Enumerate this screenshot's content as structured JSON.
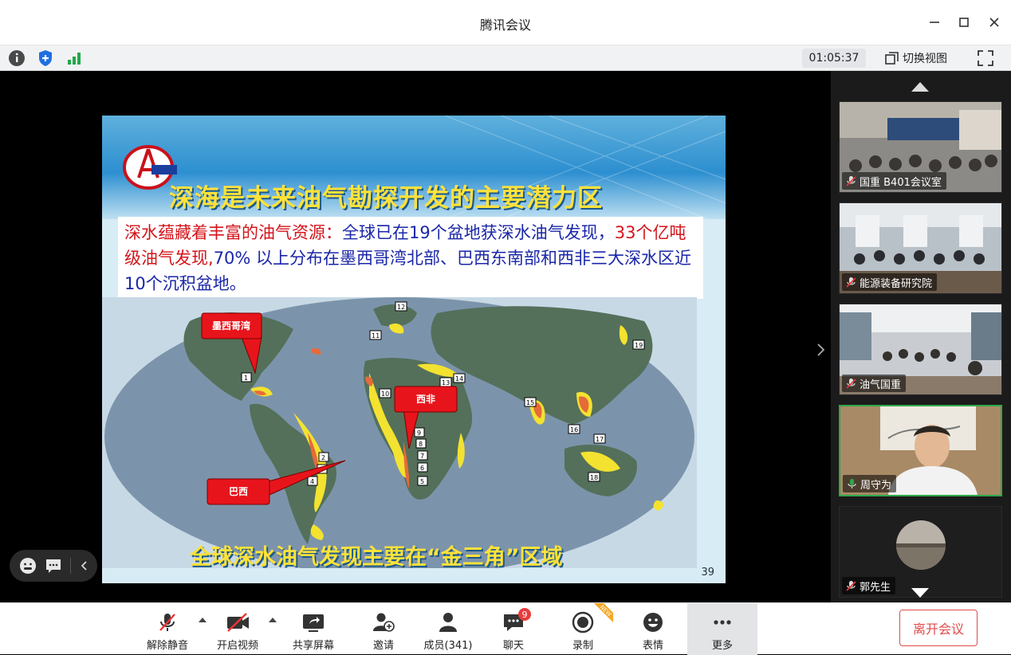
{
  "window": {
    "title": "腾讯会议"
  },
  "infobar": {
    "timer": "01:05:37",
    "switch_view_label": "切换视图"
  },
  "slide": {
    "title": "深海是未来油气勘探开发的主要潜力区",
    "text_red_1": "深水蕴藏着丰富的油气资源：",
    "text_blue_1": "全球已在19个盆地获深水油气发现，",
    "text_red_2": "33个亿吨级油气发现,",
    "text_blue_2": "70% 以上分布在墨西哥湾北部、巴西东南部和西非三大深水区近10个沉积盆地。",
    "callouts": {
      "mexico": "墨西哥湾",
      "west_africa": "西非",
      "brazil": "巴西"
    },
    "map_numbers": [
      "1",
      "2",
      "3",
      "4",
      "5",
      "6",
      "7",
      "8",
      "9",
      "10",
      "11",
      "12",
      "13",
      "14",
      "15",
      "16",
      "17",
      "18",
      "19"
    ],
    "footer": "全球深水油气发现主要在“金三角”区域",
    "page_number": "39"
  },
  "participants": [
    {
      "name": "国重 B401会议室",
      "muted": true
    },
    {
      "name": "能源装备研究院",
      "muted": true
    },
    {
      "name": "油气国重",
      "muted": true
    },
    {
      "name": "周守为",
      "muted": false
    },
    {
      "name": "郭先生",
      "muted": true
    }
  ],
  "toolbar": {
    "unmute": "解除静音",
    "start_video": "开启视频",
    "share_screen": "共享屏幕",
    "invite": "邀请",
    "members": "成员(341)",
    "chat": "聊天",
    "chat_badge": "9",
    "record": "录制",
    "new_tag": "NEW",
    "emoji": "表情",
    "more": "更多",
    "leave": "离开会议"
  },
  "colors": {
    "accent_green": "#2ea84a",
    "leave_red": "#e14b4b",
    "slide_title_yellow": "#ffe23a"
  }
}
